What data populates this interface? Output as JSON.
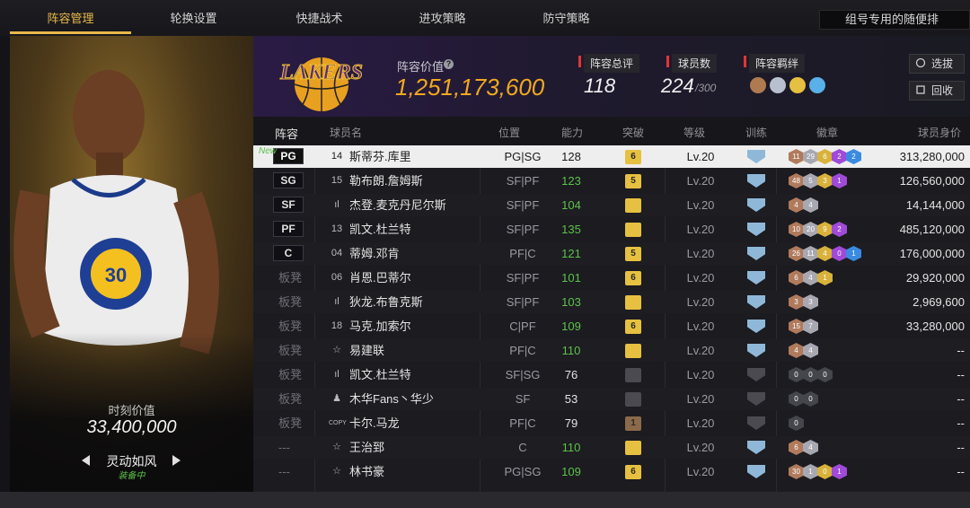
{
  "tabs": [
    "阵容管理",
    "轮换设置",
    "快捷战术",
    "进攻策略",
    "防守策略"
  ],
  "dropdown": "组号专用的随便排",
  "player_card": {
    "price_label": "时刻价值",
    "price": "33,400,000",
    "name": "灵动如风",
    "status": "装备中"
  },
  "team": {
    "logo_text": "LAKERS",
    "value_label": "阵容价值",
    "value": "1,251,173,600"
  },
  "stats": [
    {
      "label": "阵容总评",
      "value": "118",
      "suffix": ""
    },
    {
      "label": "球员数",
      "value": "224",
      "suffix": "/300"
    },
    {
      "label": "阵容羁绊",
      "value": "",
      "suffix": ""
    }
  ],
  "buttons": {
    "select": "选拔",
    "recycle": "回收"
  },
  "headers": [
    "阵容",
    "球员名",
    "位置",
    "能力",
    "突破",
    "等级",
    "训练",
    "徽章",
    "球员身价"
  ],
  "rows": [
    {
      "slot": "PG",
      "new": "New",
      "icon": "14",
      "name": "斯蒂芬.库里",
      "position": "PG|SG",
      "ability": "128",
      "breakthrough": "6",
      "level": "Lv.20",
      "value": "313,280,000",
      "badges": [
        "11",
        "29",
        "6",
        "2",
        "2"
      ],
      "green": false,
      "selected": true
    },
    {
      "slot": "SG",
      "new": "",
      "icon": "15",
      "name": "勒布朗.詹姆斯",
      "position": "SF|PF",
      "ability": "123",
      "breakthrough": "5",
      "level": "Lv.20",
      "value": "126,560,000",
      "badges": [
        "48",
        "5",
        "3",
        "1"
      ],
      "green": true,
      "selected": false
    },
    {
      "slot": "SF",
      "new": "",
      "icon": "ıl",
      "name": "杰登.麦克丹尼尔斯",
      "position": "SF|PF",
      "ability": "104",
      "breakthrough": "",
      "level": "Lv.20",
      "value": "14,144,000",
      "badges": [
        "4",
        "4"
      ],
      "green": true,
      "selected": false
    },
    {
      "slot": "PF",
      "new": "",
      "icon": "13",
      "name": "凯文.杜兰特",
      "position": "SF|PF",
      "ability": "135",
      "breakthrough": "",
      "level": "Lv.20",
      "value": "485,120,000",
      "badges": [
        "10",
        "20",
        "9",
        "2"
      ],
      "green": true,
      "selected": false
    },
    {
      "slot": "C",
      "new": "",
      "icon": "04",
      "name": "蒂姆.邓肯",
      "position": "PF|C",
      "ability": "121",
      "breakthrough": "5",
      "level": "Lv.20",
      "value": "176,000,000",
      "badges": [
        "26",
        "11",
        "4",
        "0",
        "1"
      ],
      "green": true,
      "selected": false
    },
    {
      "slot": "板凳",
      "new": "",
      "icon": "06",
      "name": "肖恩.巴蒂尔",
      "position": "SF|PF",
      "ability": "101",
      "breakthrough": "6",
      "level": "Lv.20",
      "value": "29,920,000",
      "badges": [
        "6",
        "4",
        "1"
      ],
      "green": true,
      "selected": false
    },
    {
      "slot": "板凳",
      "new": "",
      "icon": "ıl",
      "name": "狄龙.布鲁克斯",
      "position": "SF|PF",
      "ability": "103",
      "breakthrough": "",
      "level": "Lv.20",
      "value": "2,969,600",
      "badges": [
        "3",
        "3"
      ],
      "green": true,
      "selected": false
    },
    {
      "slot": "板凳",
      "new": "",
      "icon": "18",
      "name": "马克.加索尔",
      "position": "C|PF",
      "ability": "109",
      "breakthrough": "6",
      "level": "Lv.20",
      "value": "33,280,000",
      "badges": [
        "15",
        "7"
      ],
      "green": true,
      "selected": false
    },
    {
      "slot": "板凳",
      "new": "",
      "icon": "☆",
      "name": "易建联",
      "position": "PF|C",
      "ability": "110",
      "breakthrough": "",
      "level": "Lv.20",
      "value": "--",
      "badges": [
        "4",
        "4"
      ],
      "green": true,
      "selected": false
    },
    {
      "slot": "板凳",
      "new": "",
      "icon": "ıl",
      "name": "凯文.杜兰特",
      "position": "SF|SG",
      "ability": "76",
      "breakthrough": "",
      "level": "Lv.20",
      "value": "--",
      "badges": [
        "0",
        "0",
        "0"
      ],
      "green": false,
      "selected": false
    },
    {
      "slot": "板凳",
      "new": "",
      "icon": "♟",
      "name": "木华Fans丶华少",
      "position": "SF",
      "ability": "53",
      "breakthrough": "",
      "level": "Lv.20",
      "value": "--",
      "badges": [
        "0",
        "0"
      ],
      "green": false,
      "selected": false
    },
    {
      "slot": "板凳",
      "new": "",
      "icon": "COPY",
      "name": "卡尔.马龙",
      "position": "PF|C",
      "ability": "79",
      "breakthrough": "1",
      "level": "Lv.20",
      "value": "--",
      "badges": [
        "0"
      ],
      "green": false,
      "selected": false
    },
    {
      "slot": "---",
      "new": "",
      "icon": "☆",
      "name": "王治郅",
      "position": "C",
      "ability": "110",
      "breakthrough": "",
      "level": "Lv.20",
      "value": "--",
      "badges": [
        "6",
        "4"
      ],
      "green": true,
      "selected": false
    },
    {
      "slot": "---",
      "new": "",
      "icon": "☆",
      "name": "林书豪",
      "position": "PG|SG",
      "ability": "109",
      "breakthrough": "6",
      "level": "Lv.20",
      "value": "--",
      "badges": [
        "30",
        "1",
        "0",
        "1"
      ],
      "green": true,
      "selected": false
    }
  ]
}
